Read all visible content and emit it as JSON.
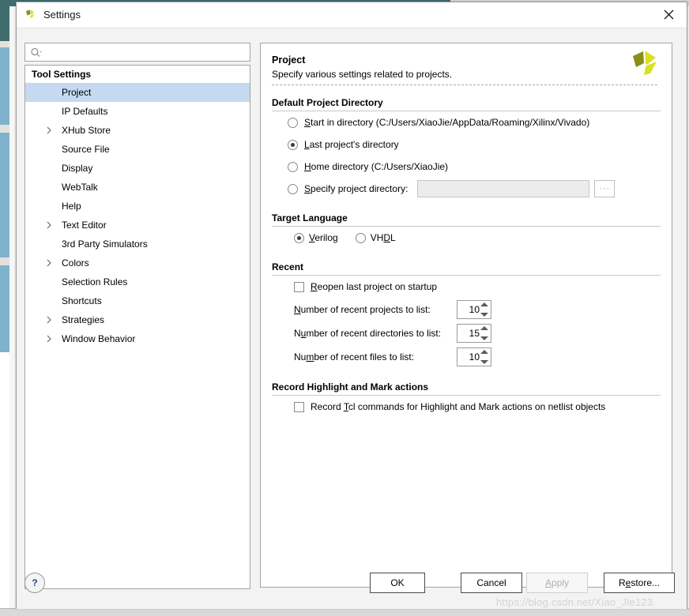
{
  "window": {
    "title": "Settings",
    "app_icon": "vivado-logo-icon",
    "close_label": "✕"
  },
  "search": {
    "value": "",
    "placeholder": "",
    "icon": "search-icon"
  },
  "sidebar": {
    "header": "Tool Settings",
    "items": [
      {
        "label": "Project",
        "expandable": false,
        "selected": true
      },
      {
        "label": "IP Defaults",
        "expandable": false,
        "selected": false
      },
      {
        "label": "XHub Store",
        "expandable": true,
        "selected": false
      },
      {
        "label": "Source File",
        "expandable": false,
        "selected": false
      },
      {
        "label": "Display",
        "expandable": false,
        "selected": false
      },
      {
        "label": "WebTalk",
        "expandable": false,
        "selected": false
      },
      {
        "label": "Help",
        "expandable": false,
        "selected": false
      },
      {
        "label": "Text Editor",
        "expandable": true,
        "selected": false
      },
      {
        "label": "3rd Party Simulators",
        "expandable": false,
        "selected": false
      },
      {
        "label": "Colors",
        "expandable": true,
        "selected": false
      },
      {
        "label": "Selection Rules",
        "expandable": false,
        "selected": false
      },
      {
        "label": "Shortcuts",
        "expandable": false,
        "selected": false
      },
      {
        "label": "Strategies",
        "expandable": true,
        "selected": false
      },
      {
        "label": "Window Behavior",
        "expandable": true,
        "selected": false
      }
    ]
  },
  "page": {
    "title": "Project",
    "subtitle": "Specify various settings related to projects.",
    "brand_icon": "xilinx-vivado-logo-icon"
  },
  "default_project_directory": {
    "section_title": "Default Project Directory",
    "options": [
      {
        "label": "Start in directory (C:/Users/XiaoJie/AppData/Roaming/Xilinx/Vivado)",
        "mnemonic": "S",
        "checked": false
      },
      {
        "label": "Last project's directory",
        "mnemonic": "L",
        "checked": true
      },
      {
        "label": "Home directory (C:/Users/XiaoJie)",
        "mnemonic": "H",
        "checked": false
      },
      {
        "label": "Specify project directory:",
        "mnemonic": "S",
        "checked": false
      }
    ],
    "path_value": "",
    "browse_label": "···"
  },
  "target_language": {
    "section_title": "Target Language",
    "options": [
      {
        "label": "Verilog",
        "mnemonic": "V",
        "checked": true
      },
      {
        "label": "VHDL",
        "mnemonic": "D",
        "checked": false
      }
    ]
  },
  "recent": {
    "section_title": "Recent",
    "reopen": {
      "label": "Reopen last project on startup",
      "mnemonic": "R",
      "checked": false
    },
    "spinners": [
      {
        "label": "Number of recent projects to list:",
        "mnemonic": "N",
        "value": "10"
      },
      {
        "label": "Number of recent directories to list:",
        "mnemonic": "u",
        "value": "15"
      },
      {
        "label": "Number of recent files to list:",
        "mnemonic": "m",
        "value": "10"
      }
    ]
  },
  "record_highlight": {
    "section_title": "Record Highlight and Mark actions",
    "checkbox": {
      "label": "Record Tcl commands for Highlight and Mark actions on netlist objects",
      "mnemonic": "T",
      "checked": false
    }
  },
  "footer": {
    "help_label": "?",
    "ok_label": "OK",
    "cancel_label": "Cancel",
    "apply_label": "Apply",
    "apply_disabled": true,
    "restore_label": "Restore..."
  },
  "watermark": "https://blog.csdn.net/Xiao_Jie123",
  "colors": {
    "selection": "#c5d9f1",
    "brand_olive": "#8a8f16",
    "brand_yellow": "#d9e021",
    "teal": "#3f6d6d",
    "blue_panel": "#7fb2cc"
  }
}
